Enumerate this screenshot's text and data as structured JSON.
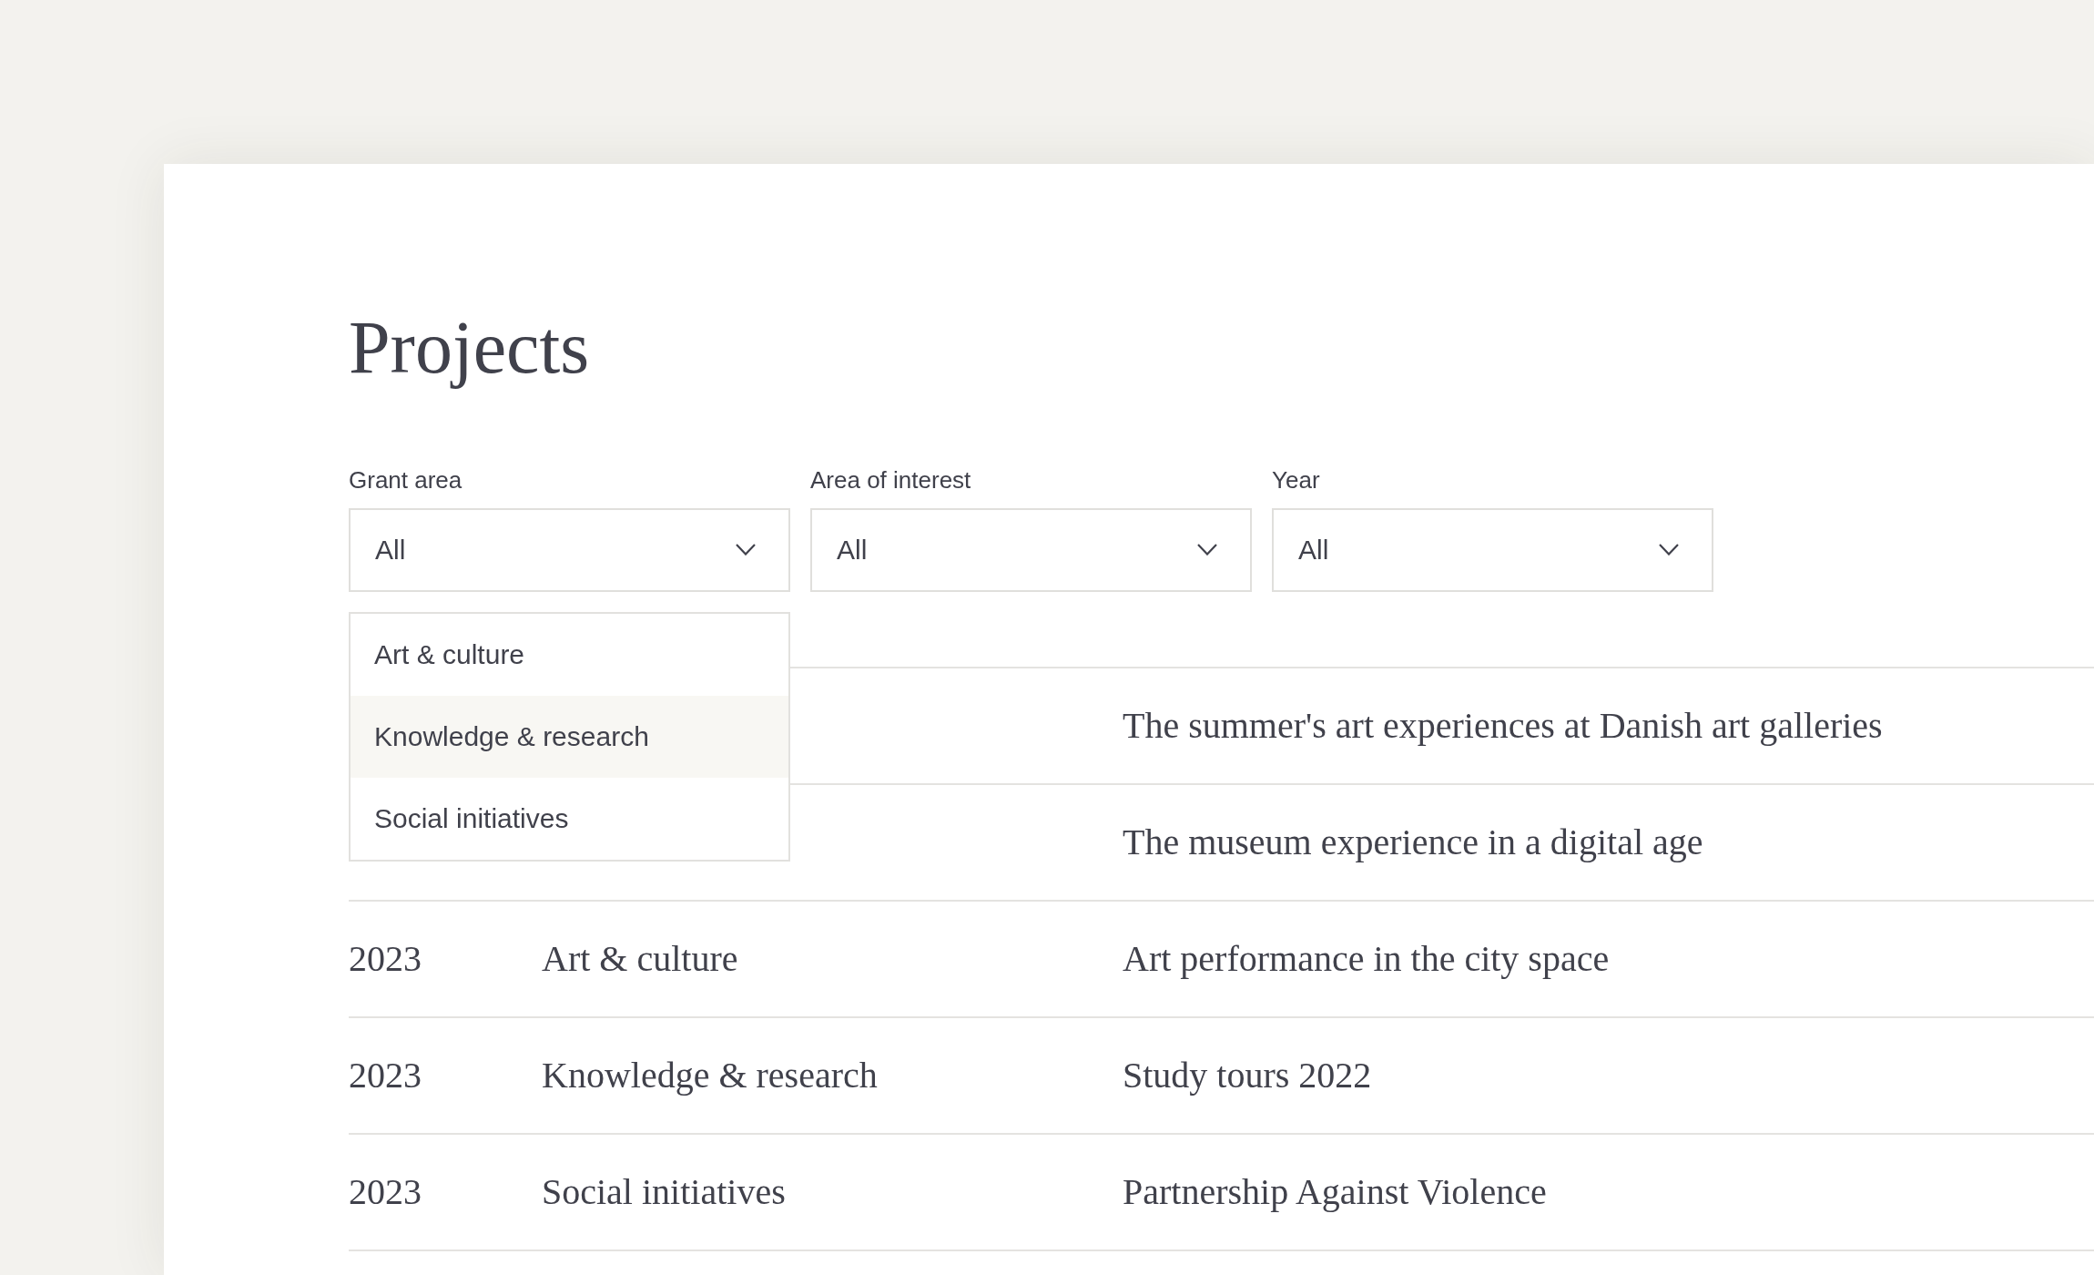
{
  "page": {
    "title": "Projects"
  },
  "filters": [
    {
      "label": "Grant area",
      "value": "All",
      "open_options": [
        {
          "label": "Art & culture",
          "highlighted": false
        },
        {
          "label": "Knowledge & research",
          "highlighted": true
        },
        {
          "label": "Social initiatives",
          "highlighted": false
        }
      ]
    },
    {
      "label": "Area of interest",
      "value": "All"
    },
    {
      "label": "Year",
      "value": "All"
    }
  ],
  "table": {
    "rows": [
      {
        "project": "The summer's art experiences at Danish art galleries"
      },
      {
        "project": "The museum experience in a digital age"
      },
      {
        "year": "2023",
        "grant_area": "Art & culture",
        "project": "Art performance in the city space"
      },
      {
        "year": "2023",
        "grant_area": "Knowledge & research",
        "project": "Study tours 2022"
      },
      {
        "year": "2023",
        "grant_area": "Social initiatives",
        "project": "Partnership Against Violence"
      }
    ]
  }
}
